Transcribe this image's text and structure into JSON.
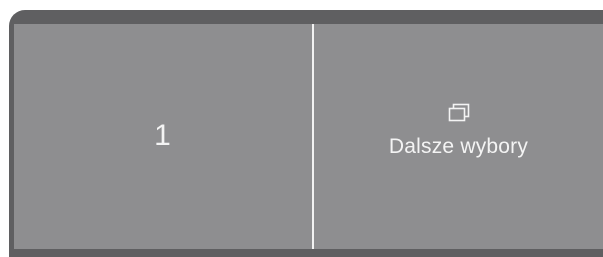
{
  "tiles": {
    "left": {
      "value": "1"
    },
    "right": {
      "icon": "windows-stack-icon",
      "label": "Dalsze wybory"
    }
  },
  "colors": {
    "frame": "#5f5f61",
    "panel": "#8e8e90",
    "text": "#f4f4f4",
    "divider": "#f2f2f2"
  }
}
